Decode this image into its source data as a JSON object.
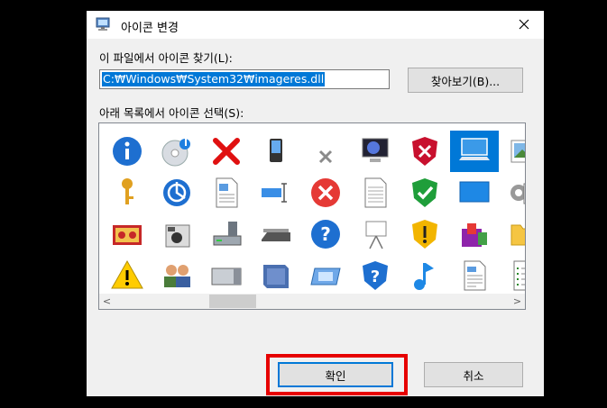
{
  "window": {
    "title": "아이콘 변경",
    "close_label": "✕"
  },
  "file_label": "이 파일에서 아이콘 찾기(L):",
  "path_input": {
    "value": "C:₩Windows₩System32₩imageres.dll"
  },
  "browse_label": "찾아보기(B)...",
  "list_label": "아래 목록에서 아이콘 선택(S):",
  "icon_grid": {
    "rows": [
      [
        "info-icon",
        "cd-music-icon",
        "red-x-icon",
        "pda-device-icon",
        "small-gray-x-icon",
        "moon-monitor-icon",
        "shield-x-icon",
        "laptop-screen-icon",
        "picture-icon"
      ],
      [
        "key-icon",
        "network-globe-icon",
        "document-image-icon",
        "text-field-icon",
        "error-circle-icon",
        "blank-document-icon",
        "shield-check-icon",
        "blue-monitor-icon",
        "gear-checklist-icon"
      ],
      [
        "photo-album-icon",
        "camera-device-icon",
        "drive-icon",
        "scanner-icon",
        "help-circle-icon",
        "projector-icon",
        "shield-warning-icon",
        "programs-icon",
        "folder-icon"
      ],
      [
        "warning-triangle-icon",
        "users-icon",
        "server-icon",
        "book-icon",
        "screen-frame-icon",
        "shield-help-icon",
        "music-note-icon",
        "document-text-icon",
        "list-document-icon"
      ]
    ],
    "selected": "laptop-screen-icon"
  },
  "scrollbar": {
    "left_arrow": "<",
    "right_arrow": ">"
  },
  "ok_label": "확인",
  "cancel_label": "취소",
  "colors": {
    "selection": "#0078d7",
    "highlight_box": "#e60000"
  }
}
